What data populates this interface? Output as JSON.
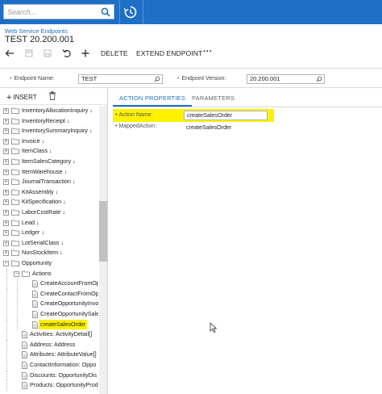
{
  "topbar": {
    "search_placeholder": "Search...",
    "icons": [
      "search-icon",
      "history-icon"
    ]
  },
  "header": {
    "breadcrumb": "Web Service Endpoints",
    "title": "TEST 20.200.001"
  },
  "toolbar": {
    "delete_label": "DELETE",
    "extend_label": "EXTEND ENDPOINT",
    "more_label": "···"
  },
  "form": {
    "endpoint_name_label": "Endpoint Name:",
    "endpoint_name_value": "TEST",
    "endpoint_version_label": "Endpoint Version:",
    "endpoint_version_value": "20.200.001"
  },
  "tree_toolbar": {
    "insert_label": "INSERT"
  },
  "tree": [
    {
      "label": "InventoryAllocationInquiry ↓",
      "level": 1,
      "kind": "folder",
      "expander": "+"
    },
    {
      "label": "InventoryReceipt ↓",
      "level": 1,
      "kind": "folder",
      "expander": "+"
    },
    {
      "label": "InventorySummaryInquiry ↓",
      "level": 1,
      "kind": "folder",
      "expander": "+"
    },
    {
      "label": "Invoice ↓",
      "level": 1,
      "kind": "folder",
      "expander": "+"
    },
    {
      "label": "ItemClass ↓",
      "level": 1,
      "kind": "folder",
      "expander": "+"
    },
    {
      "label": "ItemSalesCategory ↓",
      "level": 1,
      "kind": "folder",
      "expander": "+"
    },
    {
      "label": "ItemWarehouse ↓",
      "level": 1,
      "kind": "folder",
      "expander": "+"
    },
    {
      "label": "JournalTransaction ↓",
      "level": 1,
      "kind": "folder",
      "expander": "+"
    },
    {
      "label": "KitAssembly ↓",
      "level": 1,
      "kind": "folder",
      "expander": "+"
    },
    {
      "label": "KitSpecification ↓",
      "level": 1,
      "kind": "folder",
      "expander": "+"
    },
    {
      "label": "LaborCostRate ↓",
      "level": 1,
      "kind": "folder",
      "expander": "+"
    },
    {
      "label": "Lead ↓",
      "level": 1,
      "kind": "folder",
      "expander": "+"
    },
    {
      "label": "Ledger ↓",
      "level": 1,
      "kind": "folder",
      "expander": "+"
    },
    {
      "label": "LotSerialClass ↓",
      "level": 1,
      "kind": "folder",
      "expander": "+"
    },
    {
      "label": "NonStockItem ↓",
      "level": 1,
      "kind": "folder",
      "expander": "+"
    },
    {
      "label": "Opportunity",
      "level": 1,
      "kind": "folder",
      "expander": "−"
    },
    {
      "label": "Actions",
      "level": 2,
      "kind": "folder",
      "expander": "−"
    },
    {
      "label": "CreateAccountFromOp",
      "level": 3,
      "kind": "doc",
      "expander": ""
    },
    {
      "label": "CreateContactFromOp",
      "level": 3,
      "kind": "doc",
      "expander": ""
    },
    {
      "label": "CreateOpportunityInvo",
      "level": 3,
      "kind": "doc",
      "expander": ""
    },
    {
      "label": "CreateOpportunitySale",
      "level": 3,
      "kind": "doc",
      "expander": ""
    },
    {
      "label": "createSalesOrder",
      "level": 3,
      "kind": "doc",
      "expander": "",
      "selected": true
    },
    {
      "label": "Activities: ActivityDetail[]",
      "level": 2,
      "kind": "doc",
      "expander": ""
    },
    {
      "label": "Address: Address",
      "level": 2,
      "kind": "doc",
      "expander": ""
    },
    {
      "label": "Attributes: AttributeValue[]",
      "level": 2,
      "kind": "doc",
      "expander": ""
    },
    {
      "label": "ContactInformation: Oppo",
      "level": 2,
      "kind": "doc",
      "expander": ""
    },
    {
      "label": "Discounts: OpportunityDis",
      "level": 2,
      "kind": "doc",
      "expander": ""
    },
    {
      "label": "Products: OpportunityProd",
      "level": 2,
      "kind": "doc",
      "expander": ""
    }
  ],
  "tabs": [
    {
      "label": "ACTION PROPERTIES",
      "active": true
    },
    {
      "label": "PARAMETERS",
      "active": false
    }
  ],
  "properties": {
    "action_name_label": "Action Name:",
    "action_name_value": "createSalesOrder",
    "mapped_action_label": "MappedAction:",
    "mapped_action_value": "createSalesOrder"
  },
  "colors": {
    "topbar": "#1e6fc5",
    "accent": "#1e6fc5",
    "highlight": "#fff200"
  }
}
